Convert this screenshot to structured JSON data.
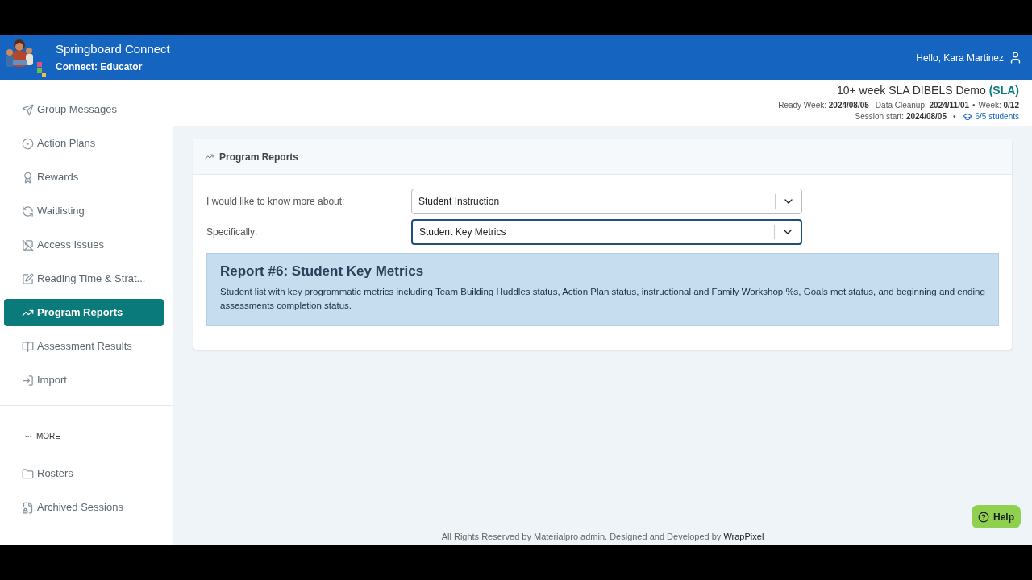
{
  "header": {
    "title": "Springboard Connect",
    "subtitle": "Connect: Educator",
    "greeting": "Hello, Kara Martinez"
  },
  "session": {
    "name": "10+ week SLA DIBELS Demo",
    "tag": "(SLA)",
    "ready_label": "Ready Week:",
    "ready_value": "2024/08/05",
    "cleanup_label": "Data Cleanup:",
    "cleanup_value": "2024/11/01",
    "week_label": "Week:",
    "week_value": "0/12",
    "start_label": "Session start:",
    "start_value": "2024/08/05",
    "students": "6/5 students",
    "separator": "•"
  },
  "sidebar": {
    "items": [
      {
        "kind": "send",
        "label": "Group Messages",
        "selected": false
      },
      {
        "kind": "target",
        "label": "Action Plans",
        "selected": false
      },
      {
        "kind": "award",
        "label": "Rewards",
        "selected": false
      },
      {
        "kind": "cycle",
        "label": "Waitlisting",
        "selected": false
      },
      {
        "kind": "blocked",
        "label": "Access Issues",
        "selected": false
      },
      {
        "kind": "edit",
        "label": "Reading Time & Strat...",
        "selected": false
      },
      {
        "kind": "trend",
        "label": "Program Reports",
        "selected": true
      },
      {
        "kind": "book",
        "label": "Assessment Results",
        "selected": false
      },
      {
        "kind": "import",
        "label": "Import",
        "selected": false
      }
    ],
    "more_label": "MORE",
    "more_items": [
      {
        "kind": "folder",
        "label": "Rosters",
        "selected": false
      },
      {
        "kind": "lock",
        "label": "Archived Sessions",
        "selected": false
      }
    ]
  },
  "card": {
    "title": "Program Reports",
    "fields": [
      {
        "label": "I would like to know more about:",
        "value": "Student Instruction",
        "focused": false
      },
      {
        "label": "Specifically:",
        "value": "Student Key Metrics",
        "focused": true
      }
    ],
    "report_title": "Report #6: Student Key Metrics",
    "report_text": "Student list with key programmatic metrics including Team Building Huddles status, Action Plan status, instructional and Family Workshop %s, Goals met status, and beginning and ending assessments completion status."
  },
  "footer": {
    "text": "All Rights Reserved by Materialpro admin. Designed and Developed by",
    "link": "WrapPixel"
  },
  "help_button": "Help"
}
